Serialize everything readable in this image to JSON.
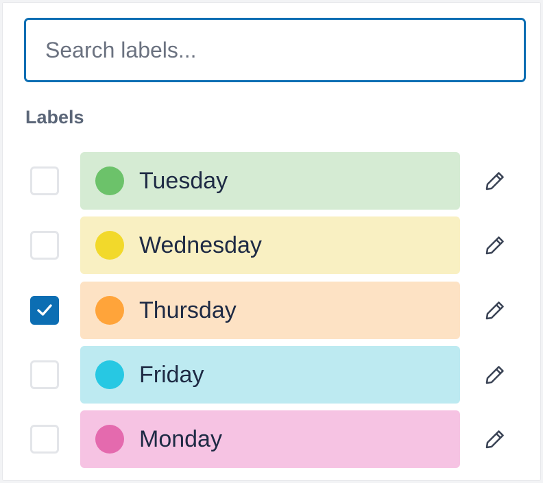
{
  "search": {
    "placeholder": "Search labels...",
    "value": ""
  },
  "section": {
    "title": "Labels"
  },
  "labels": [
    {
      "name": "Tuesday",
      "checked": false,
      "dot_color": "#6cc26a",
      "bg_color": "#d5ebd3"
    },
    {
      "name": "Wednesday",
      "checked": false,
      "dot_color": "#f2d92b",
      "bg_color": "#f9f0c2"
    },
    {
      "name": "Thursday",
      "checked": true,
      "dot_color": "#ffa43a",
      "bg_color": "#fde2c4"
    },
    {
      "name": "Friday",
      "checked": false,
      "dot_color": "#27c8e3",
      "bg_color": "#bdeaf1"
    },
    {
      "name": "Monday",
      "checked": false,
      "dot_color": "#e46aae",
      "bg_color": "#f6c3e3"
    }
  ],
  "icons": {
    "edit": "pencil-icon",
    "check": "checkmark-icon"
  },
  "colors": {
    "accent": "#0c6eb3",
    "text": "#1e2a44",
    "section_title": "#5b6678"
  }
}
